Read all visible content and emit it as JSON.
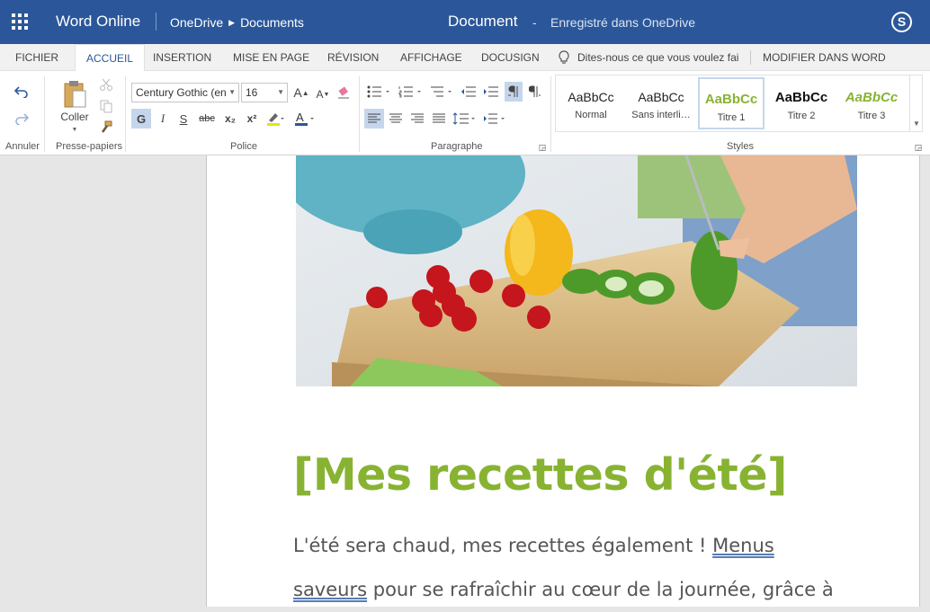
{
  "app": {
    "name": "Word Online",
    "crumb_root": "OneDrive",
    "crumb_folder": "Documents",
    "doc_title": "Document",
    "doc_dash": "-",
    "doc_status": "Enregistré dans OneDrive",
    "accent": "#2b579a"
  },
  "tabs": {
    "fichier": "FICHIER",
    "accueil": "ACCUEIL",
    "insertion": "INSERTION",
    "mise_en_page": "MISE EN PAGE",
    "revision": "RÉVISION",
    "affichage": "AFFICHAGE",
    "docusign": "DOCUSIGN",
    "modifier": "MODIFIER DANS WORD"
  },
  "tell_me": {
    "placeholder": "Dites-nous ce que vous voulez fair"
  },
  "ribbon": {
    "groups": {
      "annuler": "Annuler",
      "presse_papiers": "Presse-papiers",
      "police": "Police",
      "paragraphe": "Paragraphe",
      "styles": "Styles"
    },
    "coller": "Coller",
    "font_name": "Century Gothic (en",
    "font_size": "16",
    "bold": "G",
    "italic": "I",
    "underline": "S",
    "strike": "abc",
    "subscript": "x₂",
    "superscript": "x²",
    "grow": "A",
    "shrink": "A",
    "styles": [
      {
        "preview": "AaBbCc",
        "name": "Normal"
      },
      {
        "preview": "AaBbCc",
        "name": "Sans interli…"
      },
      {
        "preview": "AaBbCc",
        "name": "Titre 1"
      },
      {
        "preview": "AaBbCc",
        "name": "Titre 2"
      },
      {
        "preview": "AaBbCc",
        "name": "Titre 3"
      }
    ]
  },
  "document": {
    "heading": "[Mes recettes d'été]",
    "heading_color": "#88b332",
    "para_1": "L'été sera chaud, mes recettes également !",
    "link_1": "Menus",
    "link_2": "saveurs",
    "para_2": "pour se rafraîchir au cœur de la journée, grâce à"
  }
}
